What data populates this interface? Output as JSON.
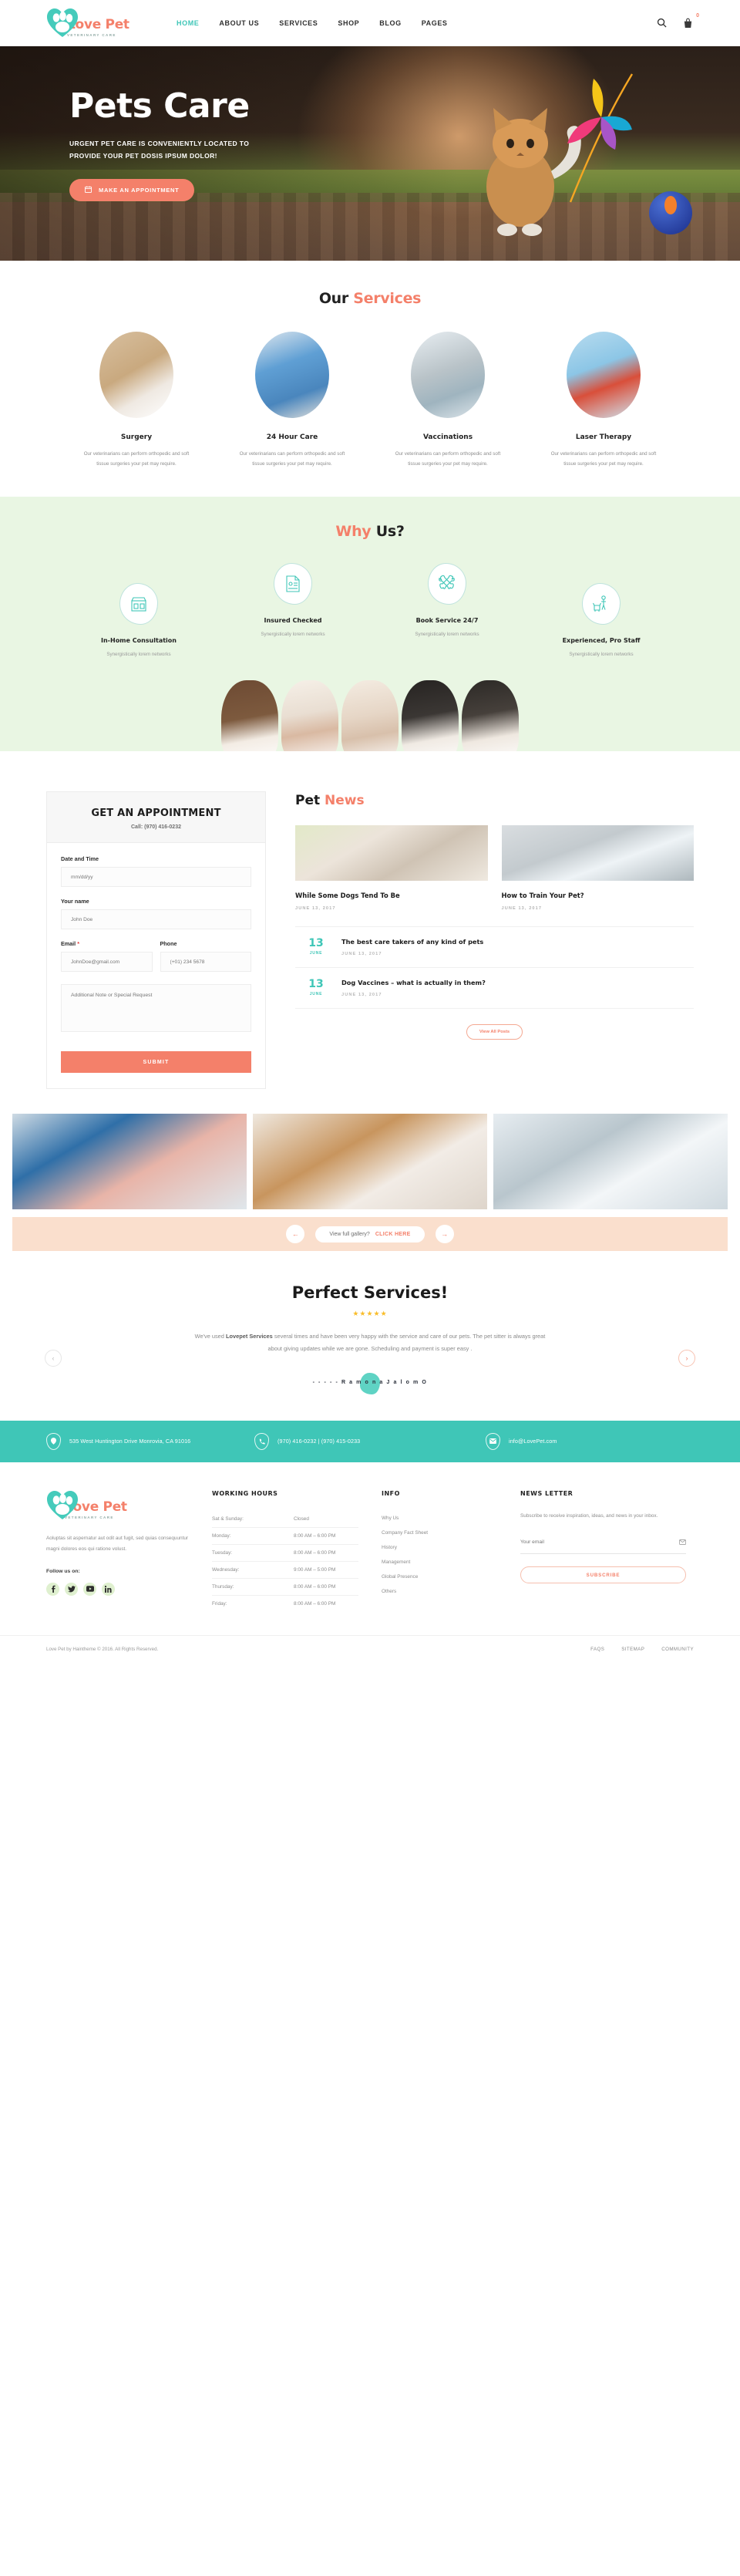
{
  "header": {
    "logo": {
      "name": "Love Pet",
      "tagline": "VETERINARY CARE",
      "icon": "paw-heart-icon"
    },
    "nav": [
      {
        "label": "HOME",
        "active": true
      },
      {
        "label": "ABOUT US",
        "active": false
      },
      {
        "label": "SERVICES",
        "active": false
      },
      {
        "label": "SHOP",
        "active": false
      },
      {
        "label": "BLOG",
        "active": false
      },
      {
        "label": "PAGES",
        "active": false
      }
    ],
    "search_icon": "search-icon",
    "cart_icon": "cart-icon",
    "cart_count": "0"
  },
  "hero": {
    "title": "Pets Care",
    "subtitle": "URGENT PET CARE IS CONVENIENTLY LOCATED TO PROVIDE YOUR PET DOSIS IPSUM DOLOR!",
    "cta": "MAKE AN APPOINTMENT",
    "cta_icon": "calendar-icon"
  },
  "services": {
    "title_1": "Our ",
    "title_2": "Services",
    "items": [
      {
        "name": "Surgery",
        "desc": "Our veterinarians can perform orthopedic and soft tissue surgeries your pet may require.",
        "img": "ph-dogbowl"
      },
      {
        "name": "24 Hour Care",
        "desc": "Our veterinarians can perform orthopedic and soft tissue surgeries your pet may require.",
        "img": "ph-vet"
      },
      {
        "name": "Vaccinations",
        "desc": "Our veterinarians can perform orthopedic and soft tissue surgeries your pet may require.",
        "img": "ph-rabbit"
      },
      {
        "name": "Laser Therapy",
        "desc": "Our veterinarians can perform orthopedic and soft tissue surgeries your pet may require.",
        "img": "ph-laser"
      }
    ]
  },
  "whyus": {
    "title_1": "Why ",
    "title_2": "Us?",
    "items": [
      {
        "name": "In-Home Consultation",
        "desc": "Synergistically lorem networks",
        "icon": "pet-shop-icon"
      },
      {
        "name": "Insured Checked",
        "desc": "Synergistically lorem networks",
        "icon": "document-icon"
      },
      {
        "name": "Book Service 24/7",
        "desc": "Synergistically lorem networks",
        "icon": "bones-icon"
      },
      {
        "name": "Experienced, Pro Staff",
        "desc": "Synergistically lorem networks",
        "icon": "staff-dog-icon"
      }
    ]
  },
  "appointment": {
    "title": "GET AN APPOINTMENT",
    "call": "Call: (970) 416-0232",
    "label_datetime": "Date and Time",
    "placeholder_datetime": "mm/dd/yy",
    "label_name": "Your name",
    "placeholder_name": "John Doe",
    "label_email": "Email",
    "email_required": "*",
    "placeholder_email": "JohnDoe@gmail.com",
    "label_phone": "Phone",
    "placeholder_phone": "(+01) 234 5678",
    "placeholder_note": "Additional Note or Special Request",
    "submit": "SUBMIT"
  },
  "news": {
    "title_1": "Pet ",
    "title_2": "News",
    "cards": [
      {
        "title": "While Some Dogs Tend To Be",
        "date": "JUNE 13, 2017",
        "img": "ni1"
      },
      {
        "title": "How to Train Your Pet?",
        "date": "JUNE 13, 2017",
        "img": "ni2"
      }
    ],
    "list": [
      {
        "day": "13",
        "month": "JUNE",
        "title": "The best care takers of any kind of pets",
        "date": "JUNE 13, 2017"
      },
      {
        "day": "13",
        "month": "JUNE",
        "title": "Dog Vaccines – what is actually in them?",
        "date": "JUNE 13, 2017"
      }
    ],
    "all_posts": "View All Posts"
  },
  "gallery": {
    "prev_icon": "arrow-left-icon",
    "next_icon": "arrow-right-icon",
    "text": "View full gallery?",
    "cta": "CLICK HERE"
  },
  "testimonial": {
    "title": "Perfect Services!",
    "stars": "★★★★★",
    "rating": 5,
    "quote_pre": "We've used ",
    "quote_bold": "Lovepet Services",
    "quote_post": " several times and have been very happy with the service and care of our pets. The pet sitter is always great about giving updates while we are gone. Scheduling and payment is super easy .",
    "author": "- - - - -  R a m o n a   J a l o m O",
    "prev_icon": "chevron-left-icon",
    "next_icon": "chevron-right-icon"
  },
  "contact": {
    "address": "535 West Huntington Drive Monrovia, CA 91016",
    "phone": "(970) 416-0232 | (970) 415-0233",
    "email": "info@LovePet.com",
    "address_icon": "location-pin-icon",
    "phone_icon": "phone-icon",
    "email_icon": "envelope-icon"
  },
  "footer": {
    "logo": {
      "name": "Love Pet",
      "tagline": "VETERINARY CARE"
    },
    "about": "Aoluptas sit aspernatur aut odit aut fugit, sed quias consequuntur magni dolores eos qui ratione volust.",
    "follow_label": "Follow us on:",
    "socials": [
      {
        "name": "facebook-icon",
        "glyph": "f"
      },
      {
        "name": "twitter-icon",
        "glyph": "✉"
      },
      {
        "name": "youtube-icon",
        "glyph": "▶"
      },
      {
        "name": "linkedin-icon",
        "glyph": "in"
      }
    ],
    "hours_title": "WORKING HOURS",
    "hours": [
      {
        "day": "Sat & Sunday:",
        "time": "Closed"
      },
      {
        "day": "Monday:",
        "time": "8:00 AM – 6:00 PM"
      },
      {
        "day": "Tuesday:",
        "time": "8:00 AM – 6:00 PM"
      },
      {
        "day": "Wednesday:",
        "time": "9:00 AM – 5:00 PM"
      },
      {
        "day": "Thursday:",
        "time": "8:00 AM – 6:00 PM"
      },
      {
        "day": "Friday:",
        "time": "8:00 AM – 6:00 PM"
      }
    ],
    "info_title": "INFO",
    "info_links": [
      "Why Us",
      "Company Fact Sheet",
      "History",
      "Management",
      "Global Presence",
      "Others"
    ],
    "newsletter_title": "NEWS LETTER",
    "newsletter_desc": "Subscribe to receive inspiration, ideas, and news in your inbox.",
    "newsletter_placeholder": "Your email",
    "newsletter_icon": "envelope-icon",
    "newsletter_button": "SUBSCRIBE",
    "copyright": "Love Pet by Haintheme © 2016. All Rights Reserved.",
    "bottom_links": [
      "FAQS",
      "SITEMAP",
      "COMMUNITY"
    ]
  },
  "colors": {
    "teal": "#3fc6b7",
    "coral": "#f4806a",
    "mint_bg": "#e9f6e3",
    "peach_bar": "#fadfcd",
    "star_yellow": "#f9bd2b"
  }
}
